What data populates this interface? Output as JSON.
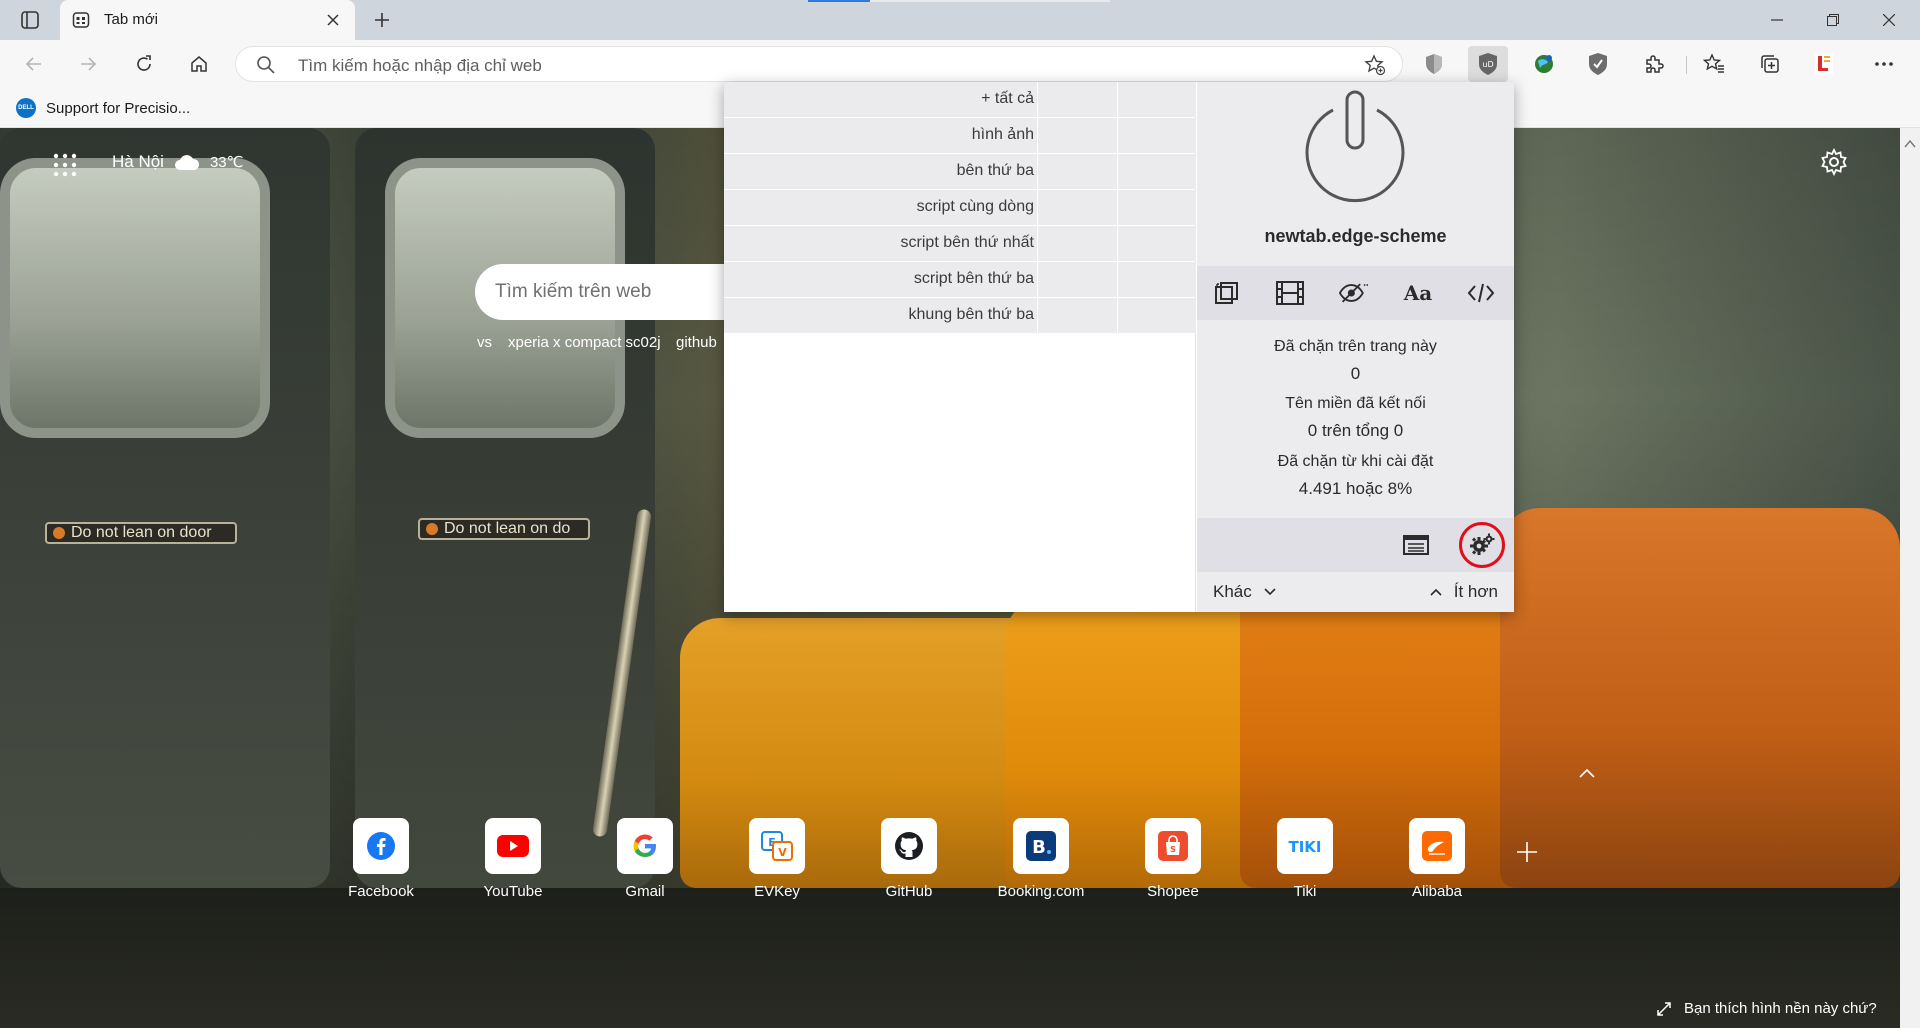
{
  "tab": {
    "title": "Tab mới"
  },
  "address": {
    "placeholder": "Tìm kiếm hoặc nhập địa chỉ web"
  },
  "favorites": {
    "item1": "Support for Precisio..."
  },
  "ntp": {
    "city": "Hà Nội",
    "temperature": "33℃",
    "search_placeholder": "Tìm kiếm trên web",
    "suggestions": [
      "vs",
      "xperia x compact sc02j",
      "github"
    ],
    "quicklinks": [
      {
        "label": "Facebook",
        "icon": "facebook-icon",
        "color": "#1877f2"
      },
      {
        "label": "YouTube",
        "icon": "youtube-icon",
        "color": "#ff0000"
      },
      {
        "label": "Gmail",
        "icon": "google-icon",
        "color": "#4285f4"
      },
      {
        "label": "EVKey",
        "icon": "evkey-icon",
        "color": "#1e88e5"
      },
      {
        "label": "GitHub",
        "icon": "github-icon",
        "color": "#1b1f23"
      },
      {
        "label": "Booking.com",
        "icon": "booking-icon",
        "color": "#0c3b7c"
      },
      {
        "label": "Shopee",
        "icon": "shopee-icon",
        "color": "#ee4d2d"
      },
      {
        "label": "Tiki",
        "icon": "tiki-icon",
        "color": "#1a94ff"
      },
      {
        "label": "Alibaba",
        "icon": "alibaba-icon",
        "color": "#ff6a00"
      }
    ],
    "bg_prompt": "Bạn thích hình nền này chứ?",
    "signs": [
      "Do not lean on door",
      "Do not lean on do"
    ]
  },
  "popup": {
    "firewall_rows": [
      "+ tất cả",
      "hình ảnh",
      "bên thứ ba",
      "script cùng dòng",
      "script bên thứ nhất",
      "script bên thứ ba",
      "khung bên thứ ba"
    ],
    "hostname": "newtab.edge-scheme",
    "tool_texts": {
      "fonts": "Aa"
    },
    "blocked_page_label": "Đã chặn trên trang này",
    "blocked_page_value": "0",
    "domains_label": "Tên miền đã kết nối",
    "domains_value": "0 trên tổng 0",
    "blocked_install_label": "Đã chặn từ khi cài đặt",
    "blocked_install_value": "4.491 hoặc 8%",
    "more_label": "Khác",
    "less_label": "Ít hơn"
  },
  "colors": {
    "highlight_ring": "#e0101a",
    "accent": "#0078d4"
  }
}
